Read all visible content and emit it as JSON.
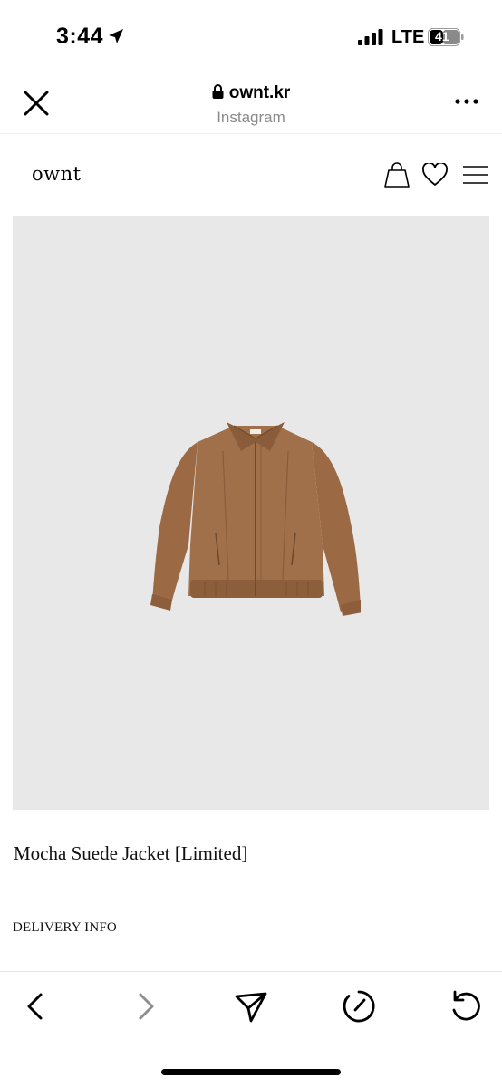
{
  "status_bar": {
    "time": "3:44",
    "network": "LTE",
    "battery_level": "41"
  },
  "browser": {
    "url": "ownt.kr",
    "source": "Instagram"
  },
  "site": {
    "logo": "ownt"
  },
  "product": {
    "title": "Mocha Suede Jacket [Limited]",
    "delivery_info": "DELIVERY INFO",
    "image_background": "#e9e8e8",
    "jacket_color": "#a0704b"
  }
}
